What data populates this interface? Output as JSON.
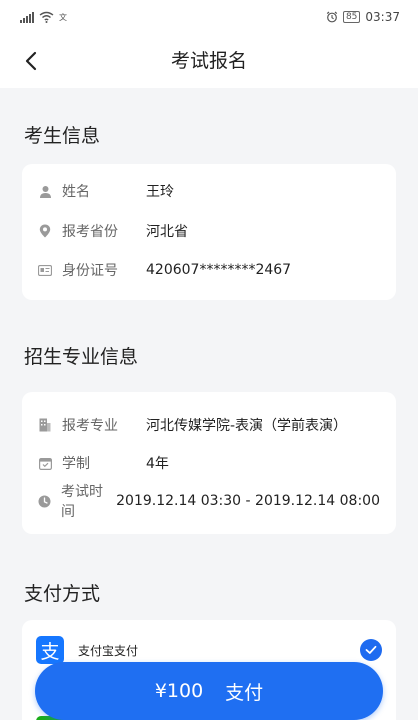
{
  "status_bar": {
    "network_type": "文",
    "battery": "85",
    "time": "03:37"
  },
  "nav": {
    "title": "考试报名"
  },
  "candidate": {
    "section_title": "考生信息",
    "rows": [
      {
        "label": "姓名",
        "value": "王玲",
        "icon": "person-icon"
      },
      {
        "label": "报考省份",
        "value": "河北省",
        "icon": "location-pin-icon"
      },
      {
        "label": "身份证号",
        "value": "420607********2467",
        "icon": "id-card-icon"
      }
    ]
  },
  "major": {
    "section_title": "招生专业信息",
    "rows": [
      {
        "label": "报考专业",
        "value": "河北传媒学院-表演（学前表演）",
        "icon": "building-icon"
      },
      {
        "label": "学制",
        "value": "4年",
        "icon": "calendar-icon"
      },
      {
        "label": "考试时间",
        "value": "2019.12.14 03:30 - 2019.12.14 08:00",
        "icon": "clock-icon"
      }
    ]
  },
  "payment": {
    "section_title": "支付方式",
    "methods": [
      {
        "name": "支付宝支付",
        "logo_glyph": "支",
        "selected": true,
        "icon": "alipay-icon"
      }
    ]
  },
  "pay_button": {
    "amount": "¥100",
    "label": "支付"
  },
  "colors": {
    "accent": "#1f6ff2",
    "alipay": "#1677ff",
    "background": "#f4f5f7"
  }
}
